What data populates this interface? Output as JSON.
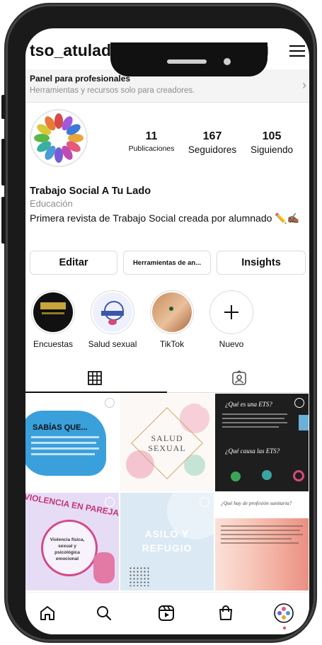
{
  "profile": {
    "username": "tso_atulado",
    "pro_panel": {
      "title": "Panel para profesionales",
      "subtitle": "Herramientas y recursos solo para creadores."
    },
    "stats": [
      {
        "value": "11",
        "label": "Publicaciones"
      },
      {
        "value": "167",
        "label": "Seguidores"
      },
      {
        "value": "105",
        "label": "Siguiendo"
      }
    ],
    "name": "Trabajo Social A Tu Lado",
    "category": "Educación",
    "bio": "Primera revista de Trabajo Social creada por alumnado ✏️✍🏾"
  },
  "actions": {
    "edit": "Editar",
    "tools": "Herramientas de an...",
    "insights": "Insights"
  },
  "highlights": [
    {
      "label": "Encuestas"
    },
    {
      "label": "Salud sexual"
    },
    {
      "label": "TikTok"
    },
    {
      "label": "Nuevo"
    }
  ],
  "posts": {
    "p1_title": "SABÍAS QUE...",
    "p2_line1": "SALUD",
    "p2_line2": "SEXUAL",
    "p3_title": "¿Qué es una ETS?",
    "p3_sub": "¿Qué causa las ETS?",
    "p4_title": "VIOLENCIA EN PAREJA",
    "p4_body": "Violencia física, sexual y psicológica emocional",
    "p5_line1": "ASILO Y",
    "p5_line2": "REFUGIO",
    "p6_title": "¿Qué hay de profesión sanitaria?"
  },
  "colors": {
    "accent_red": "#ed4956",
    "text": "#111111",
    "muted": "#8e8e8e",
    "border": "#dbdbdb"
  },
  "icons": [
    "plus-square-icon",
    "menu-icon",
    "chevron-right-icon",
    "grid-icon",
    "tagged-icon",
    "home-icon",
    "search-icon",
    "reels-icon",
    "shop-icon",
    "profile-avatar-icon"
  ]
}
